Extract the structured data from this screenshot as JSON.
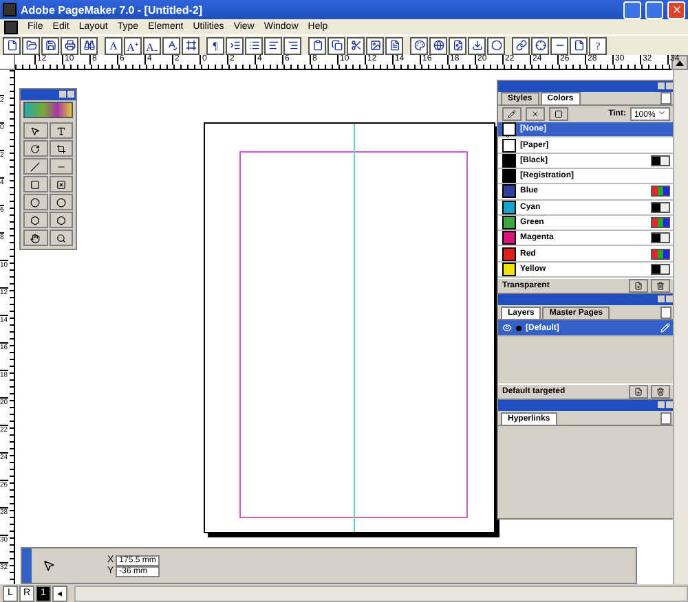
{
  "window": {
    "title": "Adobe PageMaker 7.0 - [Untitled-2]"
  },
  "menu": [
    "File",
    "Edit",
    "Layout",
    "Type",
    "Element",
    "Utilities",
    "View",
    "Window",
    "Help"
  ],
  "toolbar": [
    {
      "kind": "icon"
    },
    {
      "kind": "icon"
    },
    {
      "kind": "icon"
    },
    {
      "kind": "icon"
    },
    {
      "kind": "icon"
    },
    {
      "kind": "sep"
    },
    {
      "kind": "glyph",
      "label": "A"
    },
    {
      "kind": "glyph",
      "label": "A⁺"
    },
    {
      "kind": "glyph",
      "label": "A₋"
    },
    {
      "kind": "icon"
    },
    {
      "kind": "icon"
    },
    {
      "kind": "sep"
    },
    {
      "kind": "glyph",
      "label": "¶"
    },
    {
      "kind": "icon"
    },
    {
      "kind": "icon"
    },
    {
      "kind": "icon"
    },
    {
      "kind": "icon"
    },
    {
      "kind": "sep"
    },
    {
      "kind": "icon"
    },
    {
      "kind": "icon"
    },
    {
      "kind": "icon"
    },
    {
      "kind": "icon"
    },
    {
      "kind": "icon"
    },
    {
      "kind": "sep"
    },
    {
      "kind": "icon"
    },
    {
      "kind": "icon"
    },
    {
      "kind": "icon"
    },
    {
      "kind": "icon"
    },
    {
      "kind": "icon"
    },
    {
      "kind": "sep"
    },
    {
      "kind": "icon"
    },
    {
      "kind": "icon"
    },
    {
      "kind": "icon"
    },
    {
      "kind": "icon"
    },
    {
      "kind": "glyph",
      "label": "?"
    }
  ],
  "top_ruler": [
    "12",
    "10",
    "8",
    "6",
    "4",
    "2",
    "0",
    "2",
    "4",
    "6",
    "8",
    "10",
    "12",
    "14",
    "16",
    "18",
    "20",
    "22",
    "24",
    "26",
    "28",
    "30",
    "32",
    "34"
  ],
  "left_ruler": [
    "2",
    "0",
    "2",
    "4",
    "6",
    "8",
    "10",
    "12",
    "14",
    "16",
    "18",
    "20",
    "22",
    "24",
    "26",
    "28",
    "30",
    "32"
  ],
  "colors_panel": {
    "tabs": [
      {
        "label": "Styles",
        "selected": false
      },
      {
        "label": "Colors",
        "selected": true
      }
    ],
    "tint_label": "Tint:",
    "tint_value": "100%",
    "colors": [
      {
        "name": "[None]",
        "kind": "none",
        "selected": true
      },
      {
        "name": "[Paper]",
        "kind": "swatch",
        "color": "#ffffff",
        "selected": false
      },
      {
        "name": "[Black]",
        "kind": "swatch",
        "color": "#000000",
        "model": {
          "kind": "cmyk"
        },
        "selected": false
      },
      {
        "name": "[Registration]",
        "kind": "swatch",
        "color": "#000000",
        "selected": false
      },
      {
        "name": "Blue",
        "kind": "swatch",
        "color": "#2c3f9a",
        "model": {
          "kind": "rgb"
        },
        "selected": false
      },
      {
        "name": "Cyan",
        "kind": "swatch",
        "color": "#14a3cc",
        "model": {
          "kind": "cmyk"
        },
        "selected": false
      },
      {
        "name": "Green",
        "kind": "swatch",
        "color": "#3aa83a",
        "model": {
          "kind": "rgb"
        },
        "selected": false
      },
      {
        "name": "Magenta",
        "kind": "swatch",
        "color": "#d9157c",
        "model": {
          "kind": "cmyk"
        },
        "selected": false
      },
      {
        "name": "Red",
        "kind": "swatch",
        "color": "#e0201e",
        "model": {
          "kind": "rgb"
        },
        "selected": false
      },
      {
        "name": "Yellow",
        "kind": "swatch",
        "color": "#f2e20a",
        "model": {
          "kind": "cmyk"
        },
        "selected": false
      }
    ],
    "footer": "Transparent"
  },
  "layers_panel": {
    "tabs": [
      {
        "label": "Layers",
        "selected": true
      },
      {
        "label": "Master Pages",
        "selected": false
      }
    ],
    "layers": [
      {
        "name": "[Default]",
        "selected": true,
        "visible": true
      }
    ],
    "footer": "Default targeted"
  },
  "hyperlinks_panel": {
    "tabs": [
      {
        "label": "Hyperlinks",
        "selected": true
      }
    ]
  },
  "control_palette": {
    "x_label": "X",
    "x_value": "175.5 mm",
    "y_label": "Y",
    "y_value": "-36 mm"
  },
  "pages": [
    {
      "label": "L",
      "selected": false
    },
    {
      "label": "R",
      "selected": false
    },
    {
      "label": "1",
      "selected": true
    }
  ],
  "page_arrow": "◂"
}
